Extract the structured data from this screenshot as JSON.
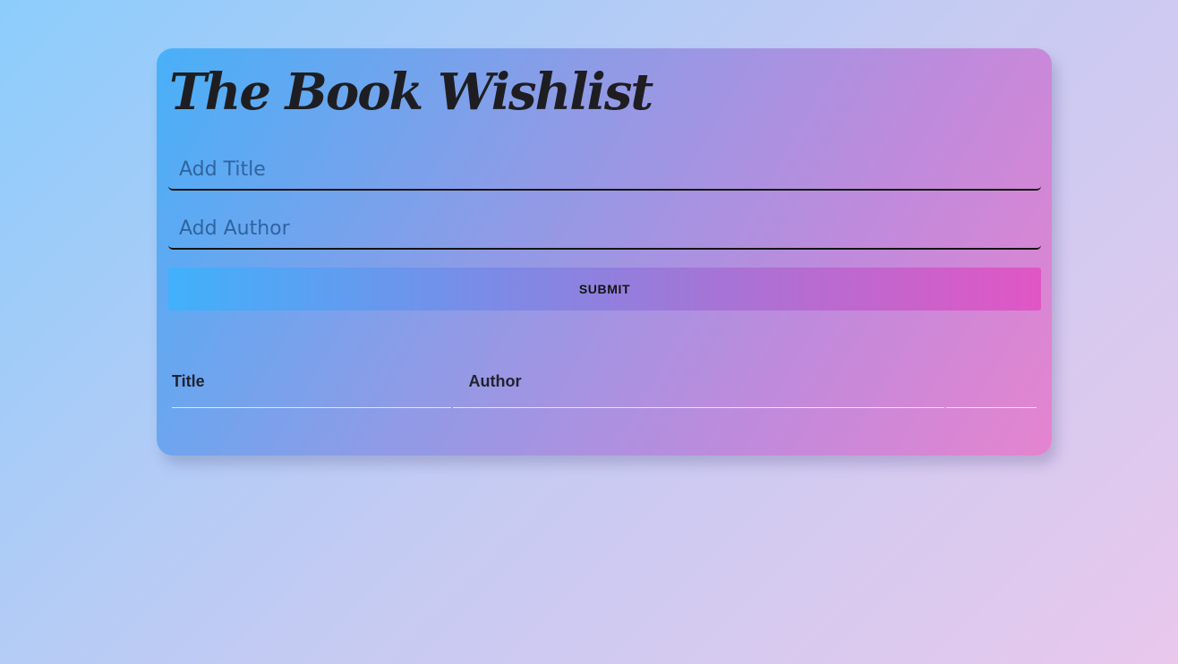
{
  "app": {
    "title": "The Book Wishlist"
  },
  "form": {
    "title_placeholder": "Add Title",
    "title_value": "",
    "author_placeholder": "Add Author",
    "author_value": "",
    "submit_label": "SUBMIT"
  },
  "table": {
    "columns": [
      "Title",
      "Author",
      ""
    ],
    "rows": []
  }
}
